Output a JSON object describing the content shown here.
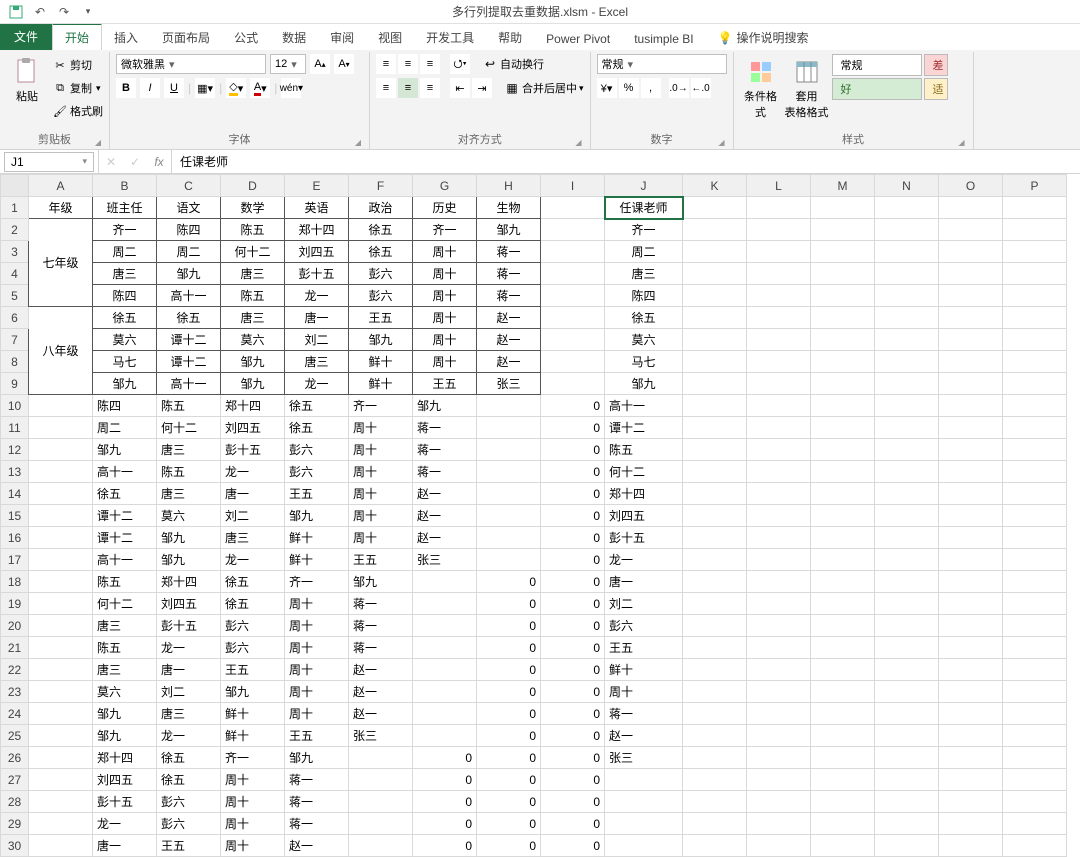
{
  "title": "多行列提取去重数据.xlsm - Excel",
  "tabs": {
    "file": "文件",
    "home": "开始",
    "insert": "插入",
    "layout": "页面布局",
    "formula": "公式",
    "data": "数据",
    "review": "审阅",
    "view": "视图",
    "dev": "开发工具",
    "help": "帮助",
    "pp": "Power Pivot",
    "tb": "tusimple BI",
    "tell": "操作说明搜索"
  },
  "ribbon": {
    "clipboard": {
      "label": "剪贴板",
      "paste": "粘贴",
      "cut": "剪切",
      "copy": "复制",
      "format": "格式刷"
    },
    "font": {
      "label": "字体",
      "name": "微软雅黑",
      "size": "12",
      "bold": "B",
      "italic": "I",
      "underline": "U"
    },
    "align": {
      "label": "对齐方式",
      "wrap": "自动换行",
      "merge": "合并后居中"
    },
    "number": {
      "label": "数字",
      "format": "常规"
    },
    "styles": {
      "label": "样式",
      "cond": "条件格式",
      "table": "套用\n表格格式",
      "normal": "常规",
      "bad": "差",
      "good": "好",
      "neutral": "适"
    }
  },
  "namebox": "J1",
  "formula": "任课老师",
  "cols": [
    "A",
    "B",
    "C",
    "D",
    "E",
    "F",
    "G",
    "H",
    "I",
    "J",
    "K",
    "L",
    "M",
    "N",
    "O",
    "P"
  ],
  "rows": [
    {
      "n": 1,
      "type": "hdr",
      "c": [
        "年级",
        "班主任",
        "语文",
        "数学",
        "英语",
        "政治",
        "历史",
        "生物",
        "",
        "任课老师"
      ]
    },
    {
      "n": 2,
      "type": "d",
      "c": [
        "",
        "齐一",
        "陈四",
        "陈五",
        "郑十四",
        "徐五",
        "齐一",
        "邹九",
        "",
        "齐一"
      ]
    },
    {
      "n": 3,
      "type": "d",
      "c": [
        "七年级",
        "周二",
        "周二",
        "何十二",
        "刘四五",
        "徐五",
        "周十",
        "蒋一",
        "",
        "周二"
      ]
    },
    {
      "n": 4,
      "type": "d",
      "c": [
        "",
        "唐三",
        "邹九",
        "唐三",
        "彭十五",
        "彭六",
        "周十",
        "蒋一",
        "",
        "唐三"
      ]
    },
    {
      "n": 5,
      "type": "d",
      "c": [
        "",
        "陈四",
        "高十一",
        "陈五",
        "龙一",
        "彭六",
        "周十",
        "蒋一",
        "",
        "陈四"
      ]
    },
    {
      "n": 6,
      "type": "d",
      "c": [
        "",
        "徐五",
        "徐五",
        "唐三",
        "唐一",
        "王五",
        "周十",
        "赵一",
        "",
        "徐五"
      ]
    },
    {
      "n": 7,
      "type": "d",
      "c": [
        "八年级",
        "莫六",
        "谭十二",
        "莫六",
        "刘二",
        "邹九",
        "周十",
        "赵一",
        "",
        "莫六"
      ]
    },
    {
      "n": 8,
      "type": "d",
      "c": [
        "",
        "马七",
        "谭十二",
        "邹九",
        "唐三",
        "鲜十",
        "周十",
        "赵一",
        "",
        "马七"
      ]
    },
    {
      "n": 9,
      "type": "d",
      "c": [
        "",
        "邹九",
        "高十一",
        "邹九",
        "龙一",
        "鲜十",
        "王五",
        "张三",
        "",
        "邹九"
      ]
    },
    {
      "n": 10,
      "type": "p",
      "c": [
        "",
        "陈四",
        "陈五",
        "郑十四",
        "徐五",
        "齐一",
        "邹九",
        "",
        "0",
        "高十一"
      ]
    },
    {
      "n": 11,
      "type": "p",
      "c": [
        "",
        "周二",
        "何十二",
        "刘四五",
        "徐五",
        "周十",
        "蒋一",
        "",
        "0",
        "谭十二"
      ]
    },
    {
      "n": 12,
      "type": "p",
      "c": [
        "",
        "邹九",
        "唐三",
        "彭十五",
        "彭六",
        "周十",
        "蒋一",
        "",
        "0",
        "陈五"
      ]
    },
    {
      "n": 13,
      "type": "p",
      "c": [
        "",
        "高十一",
        "陈五",
        "龙一",
        "彭六",
        "周十",
        "蒋一",
        "",
        "0",
        "何十二"
      ]
    },
    {
      "n": 14,
      "type": "p",
      "c": [
        "",
        "徐五",
        "唐三",
        "唐一",
        "王五",
        "周十",
        "赵一",
        "",
        "0",
        "郑十四"
      ]
    },
    {
      "n": 15,
      "type": "p",
      "c": [
        "",
        "谭十二",
        "莫六",
        "刘二",
        "邹九",
        "周十",
        "赵一",
        "",
        "0",
        "刘四五"
      ]
    },
    {
      "n": 16,
      "type": "p",
      "c": [
        "",
        "谭十二",
        "邹九",
        "唐三",
        "鲜十",
        "周十",
        "赵一",
        "",
        "0",
        "彭十五"
      ]
    },
    {
      "n": 17,
      "type": "p",
      "c": [
        "",
        "高十一",
        "邹九",
        "龙一",
        "鲜十",
        "王五",
        "张三",
        "",
        "0",
        "龙一"
      ]
    },
    {
      "n": 18,
      "type": "p",
      "c": [
        "",
        "陈五",
        "郑十四",
        "徐五",
        "齐一",
        "邹九",
        "",
        "0",
        "0",
        "唐一"
      ]
    },
    {
      "n": 19,
      "type": "p",
      "c": [
        "",
        "何十二",
        "刘四五",
        "徐五",
        "周十",
        "蒋一",
        "",
        "0",
        "0",
        "刘二"
      ]
    },
    {
      "n": 20,
      "type": "p",
      "c": [
        "",
        "唐三",
        "彭十五",
        "彭六",
        "周十",
        "蒋一",
        "",
        "0",
        "0",
        "彭六"
      ]
    },
    {
      "n": 21,
      "type": "p",
      "c": [
        "",
        "陈五",
        "龙一",
        "彭六",
        "周十",
        "蒋一",
        "",
        "0",
        "0",
        "王五"
      ]
    },
    {
      "n": 22,
      "type": "p",
      "c": [
        "",
        "唐三",
        "唐一",
        "王五",
        "周十",
        "赵一",
        "",
        "0",
        "0",
        "鲜十"
      ]
    },
    {
      "n": 23,
      "type": "p",
      "c": [
        "",
        "莫六",
        "刘二",
        "邹九",
        "周十",
        "赵一",
        "",
        "0",
        "0",
        "周十"
      ]
    },
    {
      "n": 24,
      "type": "p",
      "c": [
        "",
        "邹九",
        "唐三",
        "鲜十",
        "周十",
        "赵一",
        "",
        "0",
        "0",
        "蒋一"
      ]
    },
    {
      "n": 25,
      "type": "p",
      "c": [
        "",
        "邹九",
        "龙一",
        "鲜十",
        "王五",
        "张三",
        "",
        "0",
        "0",
        "赵一"
      ]
    },
    {
      "n": 26,
      "type": "p",
      "c": [
        "",
        "郑十四",
        "徐五",
        "齐一",
        "邹九",
        "",
        "0",
        "0",
        "0",
        "张三"
      ]
    },
    {
      "n": 27,
      "type": "p",
      "c": [
        "",
        "刘四五",
        "徐五",
        "周十",
        "蒋一",
        "",
        "0",
        "0",
        "0",
        ""
      ]
    },
    {
      "n": 28,
      "type": "p",
      "c": [
        "",
        "彭十五",
        "彭六",
        "周十",
        "蒋一",
        "",
        "0",
        "0",
        "0",
        ""
      ]
    },
    {
      "n": 29,
      "type": "p",
      "c": [
        "",
        "龙一",
        "彭六",
        "周十",
        "蒋一",
        "",
        "0",
        "0",
        "0",
        ""
      ]
    },
    {
      "n": 30,
      "type": "p",
      "c": [
        "",
        "唐一",
        "王五",
        "周十",
        "赵一",
        "",
        "0",
        "0",
        "0",
        ""
      ]
    }
  ]
}
